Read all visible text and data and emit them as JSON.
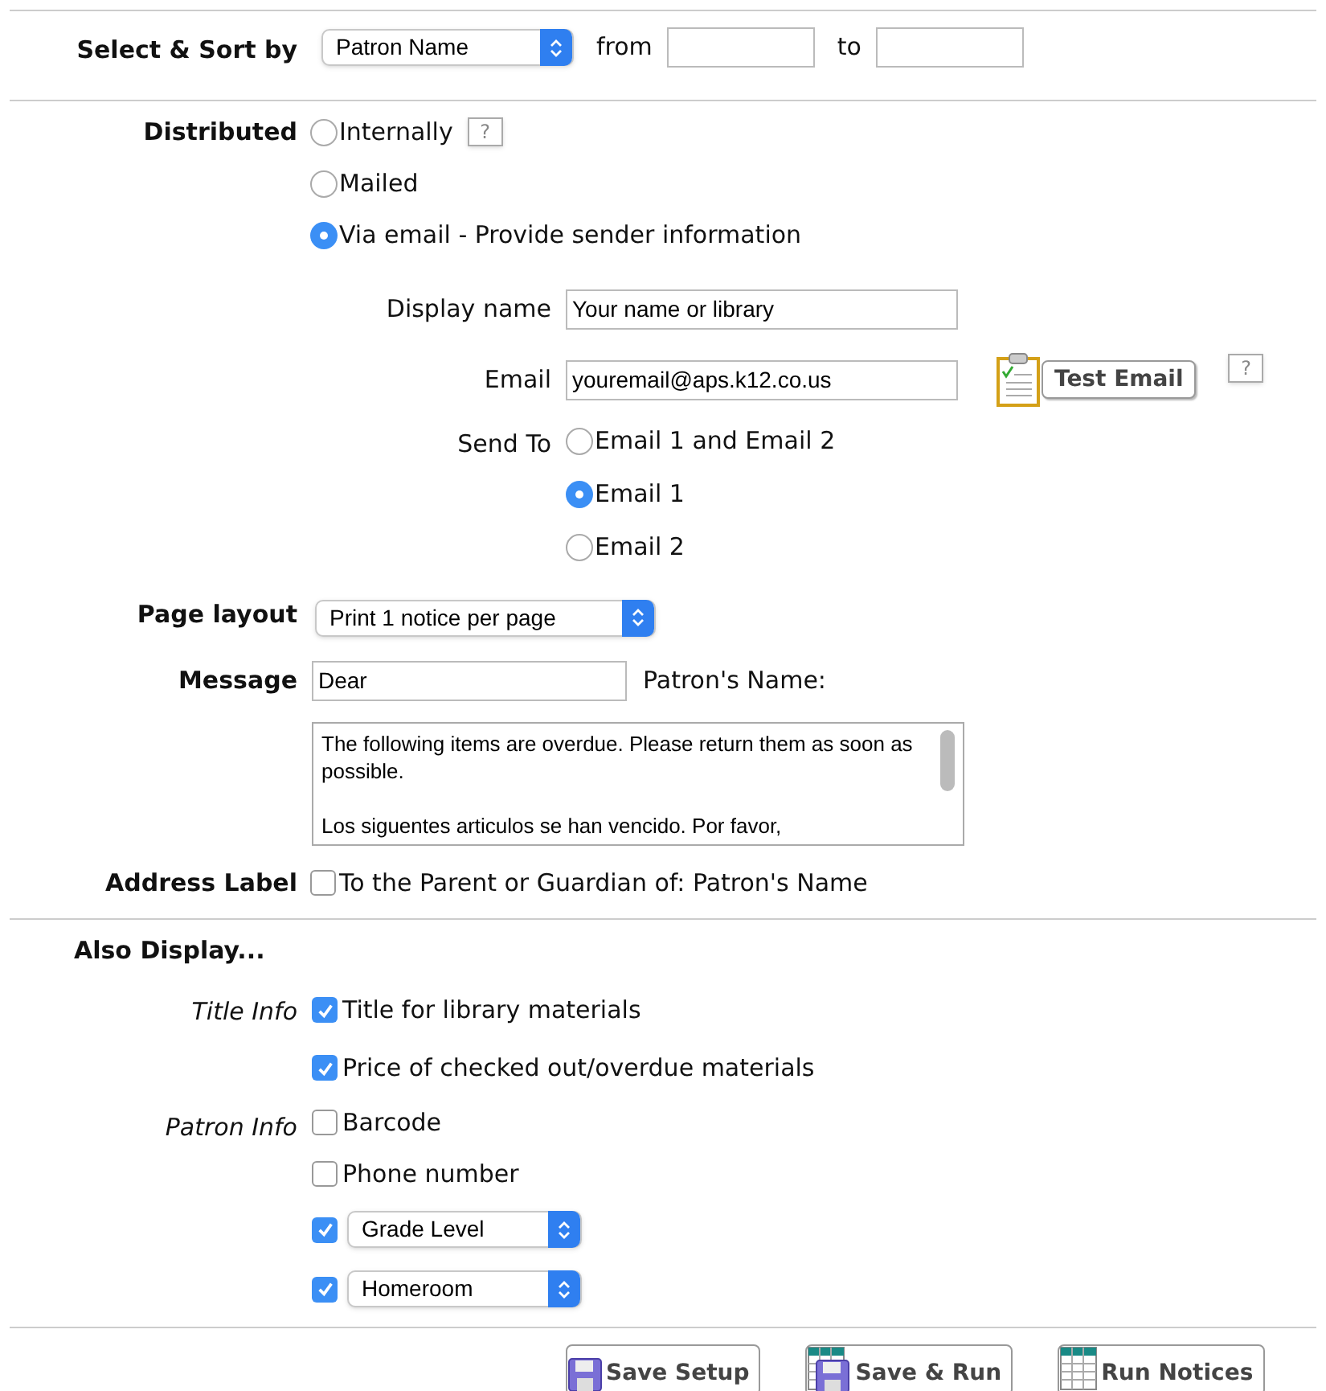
{
  "select_sort": {
    "label": "Select & Sort by",
    "value": "Patron Name",
    "from_label": "from",
    "to_label": "to"
  },
  "distributed": {
    "label": "Distributed",
    "help": "?",
    "options": [
      {
        "label": "Internally",
        "selected": false
      },
      {
        "label": "Mailed",
        "selected": false
      },
      {
        "label": "Via email - Provide sender information",
        "selected": true
      }
    ]
  },
  "sender": {
    "display_name": {
      "label": "Display name",
      "value": "Your name or library"
    },
    "email": {
      "label": "Email",
      "value": "youremail@aps.k12.co.us",
      "test_button": "Test Email",
      "help": "?"
    },
    "send_to": {
      "label": "Send To",
      "options": [
        {
          "label": "Email 1 and Email 2",
          "selected": false
        },
        {
          "label": "Email 1",
          "selected": true
        },
        {
          "label": "Email 2",
          "selected": false
        }
      ]
    }
  },
  "page_layout": {
    "label": "Page layout",
    "value": "Print 1 notice per page"
  },
  "message": {
    "label": "Message",
    "value": "Dear",
    "suffix": "Patron's Name:",
    "body": [
      "The following items are overdue. Please return them as soon as possible.",
      "Los siguentes articulos se han vencido.  Por favor,"
    ]
  },
  "address_label": {
    "label": "Address Label",
    "checked": false,
    "text": "To the Parent or Guardian of: Patron's Name"
  },
  "also_display": {
    "title": "Also Display...",
    "groups": [
      {
        "label": "Title Info",
        "items": [
          {
            "kind": "checkbox",
            "label": "Title for library materials",
            "checked": true
          },
          {
            "kind": "checkbox",
            "label": "Price of checked out/overdue materials",
            "checked": true
          }
        ]
      },
      {
        "label": "Patron Info",
        "items": [
          {
            "kind": "checkbox",
            "label": "Barcode",
            "checked": false
          },
          {
            "kind": "checkbox",
            "label": "Phone number",
            "checked": false
          },
          {
            "kind": "select",
            "value": "Grade Level",
            "checked": true
          },
          {
            "kind": "select",
            "value": "Homeroom",
            "checked": true
          }
        ]
      }
    ]
  },
  "buttons": [
    {
      "kind": "save",
      "label": "Save Setup"
    },
    {
      "kind": "save_run",
      "label": "Save & Run"
    },
    {
      "kind": "run",
      "label": "Run Notices"
    }
  ]
}
